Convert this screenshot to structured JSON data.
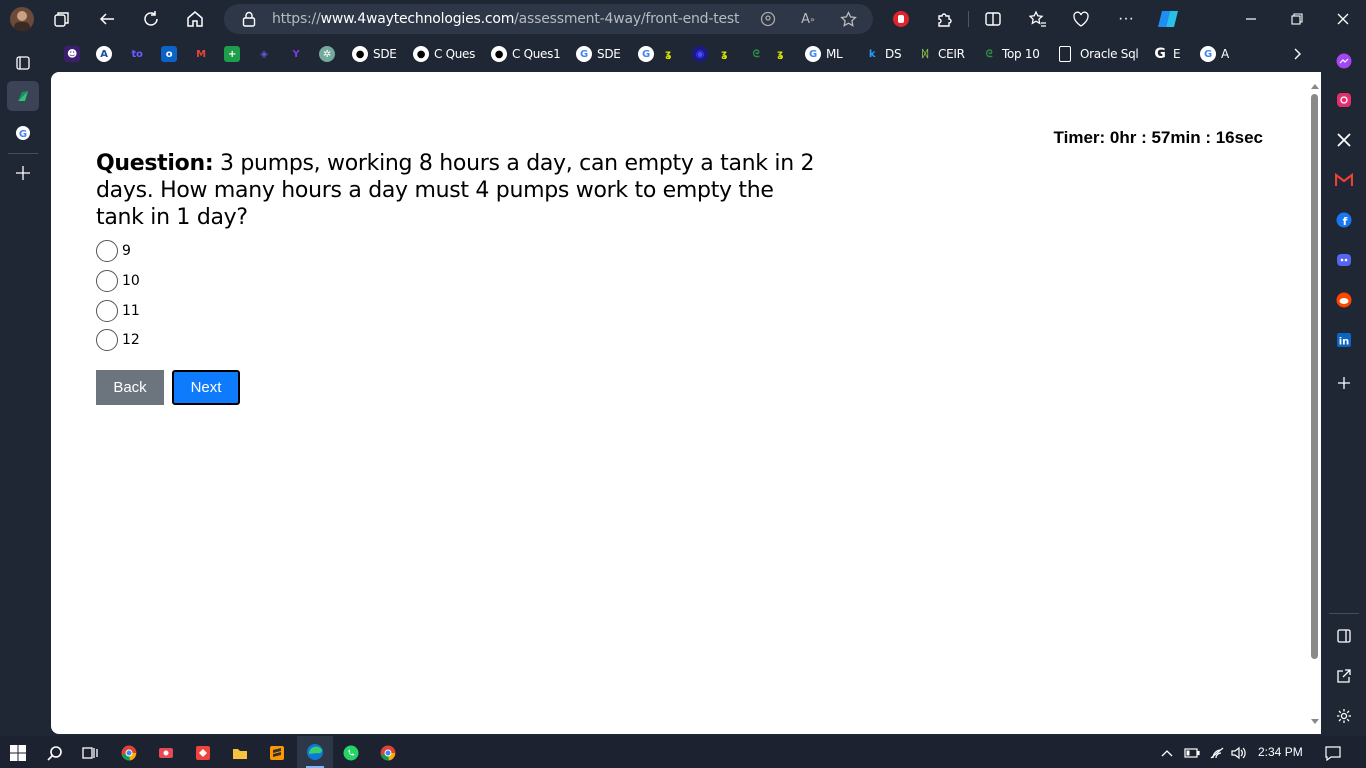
{
  "browser": {
    "url_prefix": "https://",
    "url_host": "www.4waytechnologies.com",
    "url_path": "/assessment-4way/front-end-test"
  },
  "bookmarks": [
    {
      "label": "SDE",
      "icon": "github-icon"
    },
    {
      "label": "C Ques",
      "icon": "github-icon"
    },
    {
      "label": "C Ques1",
      "icon": "github-icon"
    },
    {
      "label": "SDE",
      "icon": "google-icon"
    },
    {
      "label": "ML",
      "icon": "google-icon"
    },
    {
      "label": "DS",
      "icon": "k-icon"
    },
    {
      "label": "CEIR",
      "icon": "ceir-icon"
    },
    {
      "label": "Top 10",
      "icon": "gfg-icon"
    },
    {
      "label": "Oracle Sql",
      "icon": "page-icon"
    },
    {
      "label": "E",
      "icon": "g-icon"
    },
    {
      "label": "A",
      "icon": "google-icon"
    }
  ],
  "quiz": {
    "timer": "Timer: 0hr : 57min : 16sec",
    "question_label": "Question:",
    "question_text": " 3 pumps, working 8 hours a day, can empty a tank in 2 days. How many hours a day must 4 pumps work to empty the tank in 1 day?",
    "options": [
      "9",
      "10",
      "11",
      "12"
    ],
    "back_label": "Back",
    "next_label": "Next"
  },
  "taskbar": {
    "time": "2:34 PM"
  },
  "colors": {
    "chrome_bg": "#1f2634",
    "next_button": "#0d7bfb",
    "back_button": "#6c757d"
  }
}
